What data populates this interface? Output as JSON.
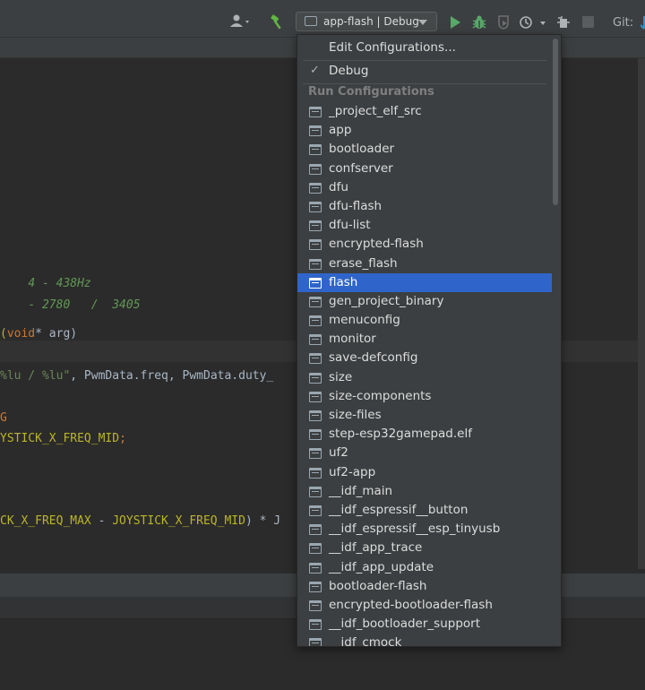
{
  "toolbar": {
    "run_config_label": "app-flash | Debug",
    "git_label": "Git:"
  },
  "code_lines": {
    "l1_comment": "4 - 438Hz",
    "l2_comment": "- 2780   /  3405",
    "l3_pre": "(",
    "l3_kw": "void",
    "l3_post": "* arg)",
    "l4_str": "%lu / %lu\"",
    "l4_post": ", PwmData.freq, PwmData.duty_",
    "l5_macro": "G",
    "l6_macro": "YSTICK_X_FREQ_MID",
    "l6_post": ";",
    "l7_macro1": "CK_X_FREQ_MAX",
    "l7_mid": " - ",
    "l7_macro2": "JOYSTICK_X_FREQ_MID",
    "l7_post": ") * J"
  },
  "popup": {
    "edit_configurations": "Edit Configurations...",
    "debug_check": "✓",
    "debug_label": "Debug",
    "section_title": "Run Configurations",
    "items": [
      "_project_elf_src",
      "app",
      "bootloader",
      "confserver",
      "dfu",
      "dfu-flash",
      "dfu-list",
      "encrypted-flash",
      "erase_flash",
      "flash",
      "gen_project_binary",
      "menuconfig",
      "monitor",
      "save-defconfig",
      "size",
      "size-components",
      "size-files",
      "step-esp32gamepad.elf",
      "uf2",
      "uf2-app",
      "__idf_main",
      "__idf_espressif__button",
      "__idf_espressif__esp_tinyusb",
      "__idf_app_trace",
      "__idf_app_update",
      "bootloader-flash",
      "encrypted-bootloader-flash",
      "__idf_bootloader_support",
      "__idf_cmock"
    ],
    "selected_index": 9
  },
  "colors": {
    "selection": "#2f65ca",
    "popup_bg": "#3c3f41",
    "editor_bg": "#2b2b2b"
  }
}
